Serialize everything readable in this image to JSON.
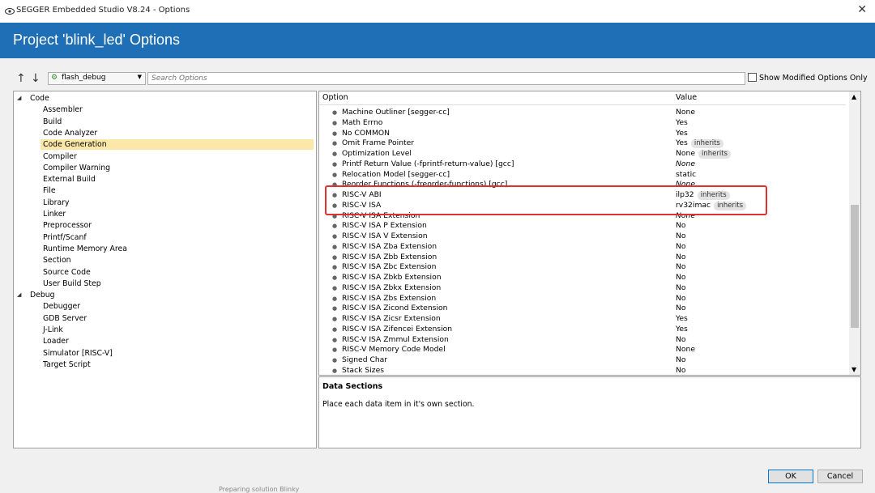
{
  "window": {
    "title": "SEGGER Embedded Studio V8.24 - Options",
    "close_glyph": "✕"
  },
  "header": {
    "title": "Project 'blink_led' Options"
  },
  "toolbar": {
    "up_glyph": "↑",
    "down_glyph": "↓",
    "config": "flash_debug",
    "search_placeholder": "Search Options",
    "show_modified_label": "Show Modified Options Only"
  },
  "tree": {
    "groups": [
      {
        "label": "Code",
        "items": [
          "Assembler",
          "Build",
          "Code Analyzer",
          "Code Generation",
          "Compiler",
          "Compiler Warning",
          "External Build",
          "File",
          "Library",
          "Linker",
          "Preprocessor",
          "Printf/Scanf",
          "Runtime Memory Area",
          "Section",
          "Source Code",
          "User Build Step"
        ]
      },
      {
        "label": "Debug",
        "items": [
          "Debugger",
          "GDB Server",
          "J-Link",
          "Loader",
          "Simulator [RISC-V]",
          "Target Script"
        ]
      }
    ],
    "selected": "Code Generation"
  },
  "options": {
    "col_option": "Option",
    "col_value": "Value",
    "rows": [
      {
        "name": "Machine Outliner [segger-cc]",
        "value": "None",
        "italic": false,
        "badge": ""
      },
      {
        "name": "Math Errno",
        "value": "Yes",
        "italic": false,
        "badge": ""
      },
      {
        "name": "No COMMON",
        "value": "Yes",
        "italic": false,
        "badge": ""
      },
      {
        "name": "Omit Frame Pointer",
        "value": "Yes",
        "italic": false,
        "badge": "inherits"
      },
      {
        "name": "Optimization Level",
        "value": "None",
        "italic": false,
        "badge": "inherits"
      },
      {
        "name": "Printf Return Value (-fprintf-return-value) [gcc]",
        "value": "None",
        "italic": true,
        "badge": ""
      },
      {
        "name": "Relocation Model [segger-cc]",
        "value": "static",
        "italic": false,
        "badge": ""
      },
      {
        "name": "Reorder Functions (-freorder-functions) [gcc]",
        "value": "None",
        "italic": true,
        "badge": ""
      },
      {
        "name": "RISC-V ABI",
        "value": "ilp32",
        "italic": false,
        "badge": "inherits"
      },
      {
        "name": "RISC-V ISA",
        "value": "rv32imac",
        "italic": false,
        "badge": "inherits"
      },
      {
        "name": "RISC-V ISA Extension",
        "value": "None",
        "italic": true,
        "badge": ""
      },
      {
        "name": "RISC-V ISA P Extension",
        "value": "No",
        "italic": false,
        "badge": ""
      },
      {
        "name": "RISC-V ISA V Extension",
        "value": "No",
        "italic": false,
        "badge": ""
      },
      {
        "name": "RISC-V ISA Zba Extension",
        "value": "No",
        "italic": false,
        "badge": ""
      },
      {
        "name": "RISC-V ISA Zbb Extension",
        "value": "No",
        "italic": false,
        "badge": ""
      },
      {
        "name": "RISC-V ISA Zbc Extension",
        "value": "No",
        "italic": false,
        "badge": ""
      },
      {
        "name": "RISC-V ISA Zbkb Extension",
        "value": "No",
        "italic": false,
        "badge": ""
      },
      {
        "name": "RISC-V ISA Zbkx Extension",
        "value": "No",
        "italic": false,
        "badge": ""
      },
      {
        "name": "RISC-V ISA Zbs Extension",
        "value": "No",
        "italic": false,
        "badge": ""
      },
      {
        "name": "RISC-V ISA Zicond Extension",
        "value": "No",
        "italic": false,
        "badge": ""
      },
      {
        "name": "RISC-V ISA Zicsr Extension",
        "value": "Yes",
        "italic": false,
        "badge": ""
      },
      {
        "name": "RISC-V ISA Zifencei Extension",
        "value": "Yes",
        "italic": false,
        "badge": ""
      },
      {
        "name": "RISC-V ISA Zmmul Extension",
        "value": "No",
        "italic": false,
        "badge": ""
      },
      {
        "name": "RISC-V Memory Code Model",
        "value": "None",
        "italic": false,
        "badge": ""
      },
      {
        "name": "Signed Char",
        "value": "No",
        "italic": false,
        "badge": ""
      },
      {
        "name": "Stack Sizes",
        "value": "No",
        "italic": false,
        "badge": ""
      }
    ]
  },
  "description": {
    "title": "Data Sections",
    "text": "Place each data item in it's own section."
  },
  "buttons": {
    "ok": "OK",
    "cancel": "Cancel"
  },
  "background_text": "Preparing solution Blinky",
  "colors": {
    "header": "#1e6fb5",
    "selection": "#fbe7a8",
    "highlight_box": "#e03030"
  }
}
